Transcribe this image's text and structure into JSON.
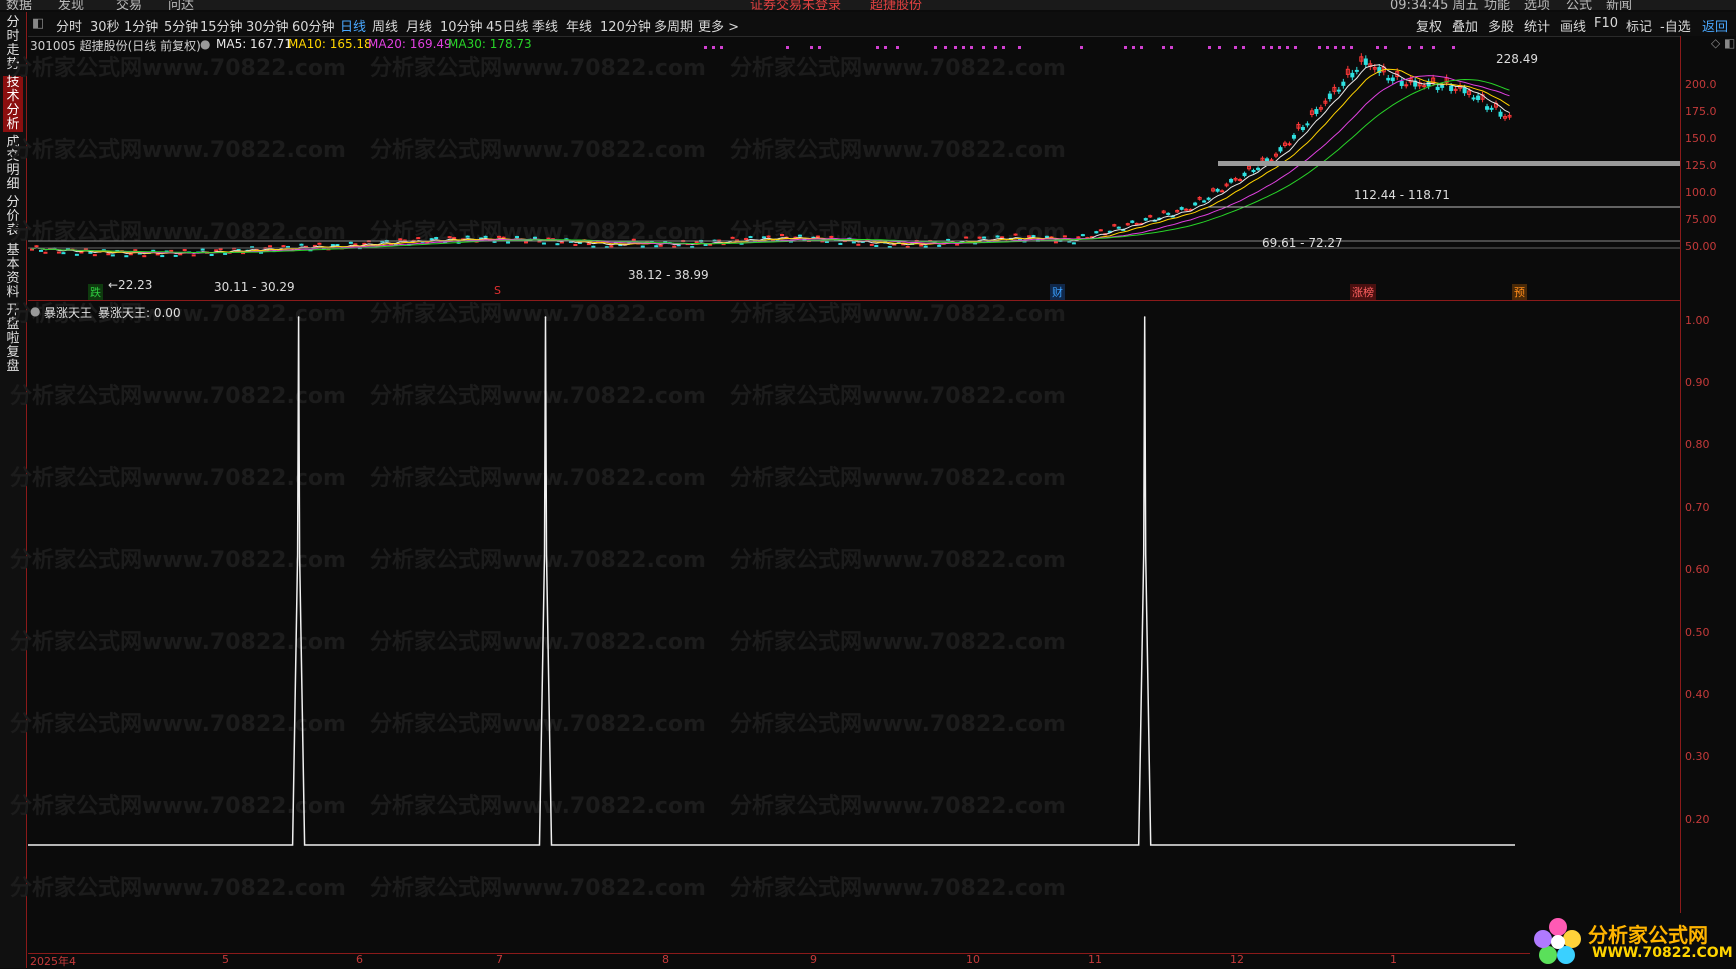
{
  "top_menu": [
    "数据",
    "发现",
    "交易",
    "问达",
    "证券交易未登录",
    "超捷股份",
    "09:34:45 周五",
    "功能",
    "选项",
    "公式",
    "新闻"
  ],
  "toolbar": {
    "periods": [
      "分时",
      "30秒",
      "1分钟",
      "5分钟",
      "15分钟",
      "30分钟",
      "60分钟",
      "日线",
      "周线",
      "月线",
      "10分钟",
      "45日线",
      "季线",
      "年线",
      "120分钟",
      "多周期",
      "更多 >"
    ],
    "active_period": "日线",
    "right_items": [
      "复权",
      "叠加",
      "多股",
      "统计",
      "画线",
      "F10",
      "标记",
      "-自选",
      "返回"
    ]
  },
  "left_tabs": [
    {
      "label": "分时走势",
      "active": false
    },
    {
      "label": "技术分析",
      "active": true
    },
    {
      "label": "成交明细",
      "active": false
    },
    {
      "label": "分价表",
      "active": false
    },
    {
      "label": "基本资料",
      "active": false
    },
    {
      "label": "开盘啦复盘",
      "active": false
    }
  ],
  "upper_info": {
    "stock": "301005 超捷股份(日线 前复权)",
    "ma5": "MA5: 167.71",
    "ma10": "MA10: 165.18",
    "ma20": "MA20: 169.49",
    "ma30": "MA30: 178.73",
    "colors": {
      "ma5": "#e8e8e8",
      "ma10": "#ffd400",
      "ma20": "#e040e0",
      "ma30": "#28d428"
    }
  },
  "upper_annotations": {
    "high": "228.49",
    "low": "←22.23",
    "range1": "30.11 - 30.29",
    "range2": "38.12 - 38.99",
    "range3": "69.61 - 72.27",
    "range4": "112.44 - 118.71"
  },
  "event_tags": [
    {
      "text": "跌",
      "color": "#2ecc40"
    },
    {
      "text": "S",
      "color": "#e03030"
    },
    {
      "text": "财",
      "color": "#3aa0ff"
    },
    {
      "text": "涨榜",
      "color": "#ff6060"
    },
    {
      "text": "预",
      "color": "#ff8c1a"
    }
  ],
  "upper_axis": [
    "200.0",
    "175.0",
    "150.0",
    "125.0",
    "100.0",
    "75.00",
    "50.00"
  ],
  "lower_info": {
    "indicator": "暴涨天王",
    "value_label": "暴涨天王: 0.00"
  },
  "lower_axis": [
    "1.00",
    "0.90",
    "0.80",
    "0.70",
    "0.60",
    "0.50",
    "0.40",
    "0.30",
    "0.20"
  ],
  "date_labels": [
    "2025年4",
    "5",
    "6",
    "7",
    "8",
    "9",
    "10",
    "11",
    "12",
    "1"
  ],
  "watermark": "分析家公式网www.70822.com",
  "logo": {
    "title": "分析家公式网",
    "url": "WWW.70822.COM"
  },
  "chart_data": {
    "type": "line",
    "name": "暴涨天王",
    "ylim": [
      0,
      1
    ],
    "spike_x_fraction": [
      0.182,
      0.348,
      0.751
    ],
    "values_at_spikes": [
      1.0,
      1.0,
      1.0
    ],
    "baseline": 0.0
  }
}
